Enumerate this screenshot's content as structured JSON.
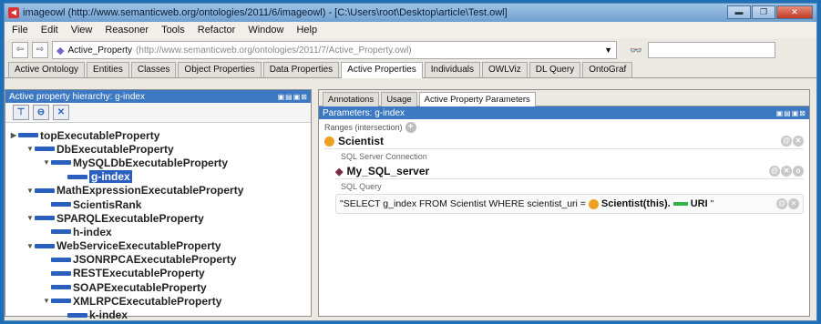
{
  "window": {
    "title": "imageowl (http://www.semanticweb.org/ontologies/2011/6/imageowl) - [C:\\Users\\root\\Desktop\\article\\Test.owl]",
    "controls": {
      "minimize": "▬",
      "maximize": "❐",
      "close": "✕"
    }
  },
  "menu": [
    "File",
    "Edit",
    "View",
    "Reasoner",
    "Tools",
    "Refactor",
    "Window",
    "Help"
  ],
  "address": {
    "back": "⇦",
    "forward": "⇨",
    "entity": "Active_Property",
    "url": "(http://www.semanticweb.org/ontologies/2011/7/Active_Property.owl)",
    "dropdown": "▼",
    "search_icon": "binoculars-icon"
  },
  "tabs": [
    "Active Ontology",
    "Entities",
    "Classes",
    "Object Properties",
    "Data Properties",
    "Active Properties",
    "Individuals",
    "OWLViz",
    "DL Query",
    "OntoGraf"
  ],
  "active_tab": "Active Properties",
  "left": {
    "header": "Active property hierarchy: g-index",
    "header_ctrls": "▣▤▣⊠",
    "toolbar": [
      "⊤",
      "⊖",
      "✕"
    ],
    "tree": [
      {
        "label": "topExecutableProperty",
        "depth": 0,
        "arrow": "▶"
      },
      {
        "label": "DbExecutableProperty",
        "depth": 1,
        "arrow": "▼"
      },
      {
        "label": "MySQLDbExecutableProperty",
        "depth": 2,
        "arrow": "▼"
      },
      {
        "label": "g-index",
        "depth": 3,
        "arrow": "",
        "selected": true
      },
      {
        "label": "MathExpressionExecutableProperty",
        "depth": 1,
        "arrow": "▼"
      },
      {
        "label": "ScientisRank",
        "depth": 2,
        "arrow": ""
      },
      {
        "label": "SPARQLExecutableProperty",
        "depth": 1,
        "arrow": "▼"
      },
      {
        "label": "h-index",
        "depth": 2,
        "arrow": ""
      },
      {
        "label": "WebServiceExecutableProperty",
        "depth": 1,
        "arrow": "▼"
      },
      {
        "label": "JSONRPCAExecutableProperty",
        "depth": 2,
        "arrow": ""
      },
      {
        "label": "RESTExecutableProperty",
        "depth": 2,
        "arrow": ""
      },
      {
        "label": "SOAPExecutableProperty",
        "depth": 2,
        "arrow": ""
      },
      {
        "label": "XMLRPCExecutableProperty",
        "depth": 2,
        "arrow": "▼"
      },
      {
        "label": "k-index",
        "depth": 3,
        "arrow": ""
      }
    ]
  },
  "right": {
    "tabs": [
      "Annotations",
      "Usage",
      "Active Property Parameters"
    ],
    "active_tab": "Active Property Parameters",
    "header": "Parameters: g-index",
    "header_ctrls": "▣▤▣⊠",
    "ranges_label": "Ranges (intersection)",
    "range_value": "Scientist",
    "conn_label": "SQL Server Connection",
    "conn_value": "My_SQL_server",
    "query_label": "SQL Query",
    "query_prefix": "\"SELECT g_index FROM Scientist WHERE scientist_uri = ",
    "query_class": "Scientist(this).",
    "query_prop": "URI",
    "query_suffix": "\""
  }
}
